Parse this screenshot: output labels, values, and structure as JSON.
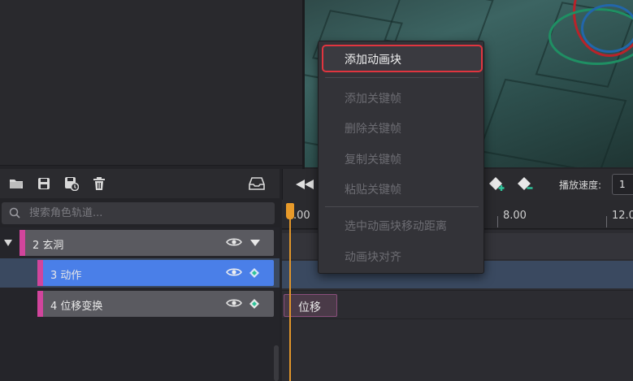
{
  "toolbar": {
    "icons": [
      "folder-open-icon",
      "save-icon",
      "save-as-icon",
      "trash-icon",
      "inbox-icon"
    ]
  },
  "search": {
    "placeholder": "搜索角色轨道..."
  },
  "tracks": [
    {
      "label": "2 玄洞",
      "type": "group",
      "accent": "#d1459c"
    },
    {
      "label": "3 动作",
      "type": "track",
      "selected": true,
      "accent": "#d1459c"
    },
    {
      "label": "4 位移变换",
      "type": "track",
      "accent": "#d1459c"
    }
  ],
  "timeline": {
    "speed_label": "播放速度:",
    "speed_value": "1",
    "ticks": [
      ".00",
      "8.00",
      "12.0"
    ],
    "clip_label": "位移"
  },
  "context_menu": {
    "items": [
      {
        "label": "添加动画块",
        "enabled": true,
        "highlighted": true
      },
      {
        "label": "添加关键帧",
        "enabled": false
      },
      {
        "label": "删除关键帧",
        "enabled": false
      },
      {
        "label": "复制关键帧",
        "enabled": false
      },
      {
        "label": "粘贴关键帧",
        "enabled": false
      },
      {
        "label": "选中动画块移动距离",
        "enabled": false
      },
      {
        "label": "动画块对齐",
        "enabled": false
      }
    ]
  },
  "colors": {
    "accent_pink": "#d1459c",
    "selected_row": "#4a7fe8",
    "playhead": "#e0952a",
    "highlight_border": "#e0353f"
  }
}
